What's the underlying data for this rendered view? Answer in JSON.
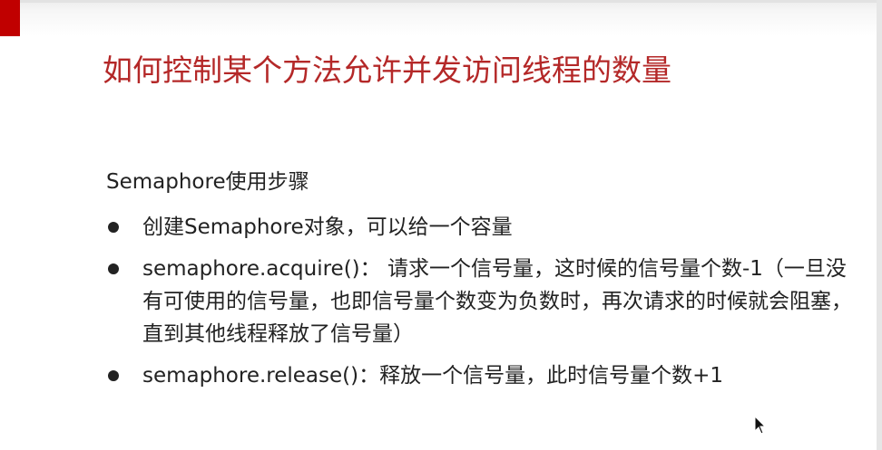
{
  "slide": {
    "title": "如何控制某个方法允许并发访问线程的数量",
    "subheading": "Semaphore使用步骤",
    "bullets": [
      "创建Semaphore对象，可以给一个容量",
      "semaphore.acquire()： 请求一个信号量，这时候的信号量个数-1（一旦没有可使用的信号量，也即信号量个数变为负数时，再次请求的时候就会阻塞，直到其他线程释放了信号量）",
      "semaphore.release()：释放一个信号量，此时信号量个数+1"
    ]
  },
  "colors": {
    "title": "#b42828",
    "accent": "#c00000",
    "text": "#222222"
  },
  "icons": {
    "cursor": "mouse-pointer-icon",
    "bullet": "bullet-dot-icon"
  }
}
